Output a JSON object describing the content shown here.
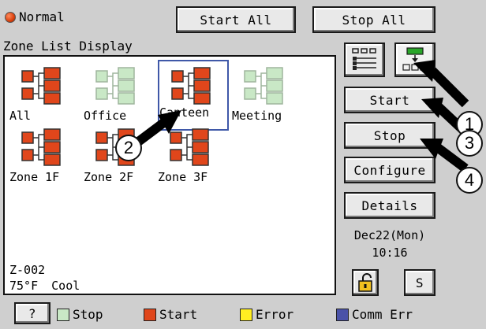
{
  "header": {
    "mode_label": "Normal",
    "start_all_label": "Start All",
    "stop_all_label": "Stop All"
  },
  "zone_list": {
    "title": "Zone List Display",
    "zones": [
      {
        "label": "All",
        "state": "active"
      },
      {
        "label": "Office",
        "state": "inactive"
      },
      {
        "label": "Canteen",
        "state": "active",
        "selected": true
      },
      {
        "label": "Meeting",
        "state": "inactive"
      },
      {
        "label": "Zone 1F",
        "state": "active"
      },
      {
        "label": "Zone 2F",
        "state": "active"
      },
      {
        "label": "Zone 3F",
        "state": "active"
      }
    ],
    "status_zone": "Z-002",
    "status_temp": "75°F",
    "status_mode": "Cool"
  },
  "side_panel": {
    "start_label": "Start",
    "stop_label": "Stop",
    "configure_label": "Configure",
    "details_label": "Details",
    "date": "Dec22(Mon)",
    "time": "10:16",
    "s_label": "S"
  },
  "footer": {
    "help_label": "?",
    "legend": [
      {
        "label": "Stop",
        "color": "#c9e8c6"
      },
      {
        "label": "Start",
        "color": "#e0461b"
      },
      {
        "label": "Error",
        "color": "#ffee22"
      },
      {
        "label": "Comm Err",
        "color": "#4a52a8"
      }
    ]
  },
  "callouts": [
    "1",
    "2",
    "3",
    "4"
  ],
  "icons": {
    "active_color": "#e0461b",
    "inactive_color": "#c9e8c6",
    "list_view_icon": "list-view-icon",
    "tree_view_icon": "tree-view-icon",
    "lock_icon": "lock-icon"
  }
}
